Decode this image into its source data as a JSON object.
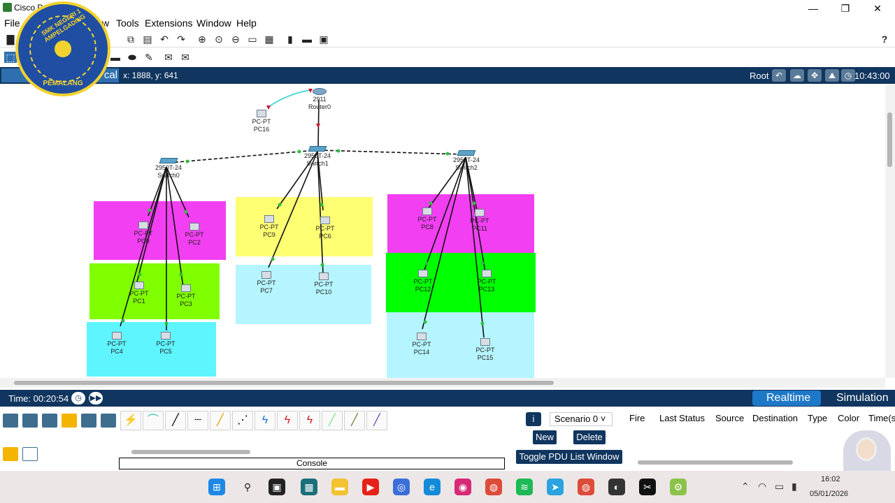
{
  "window": {
    "title": "Cisco Pa",
    "min": "—",
    "max": "❐",
    "close": "✕"
  },
  "menu": [
    "File",
    "w",
    "Tools",
    "Extensions",
    "Window",
    "Help"
  ],
  "help_icon": "?",
  "logo": {
    "top_text": "SMK NEGERI 1 AMPELGADING",
    "bottom_text": "PEMALANG"
  },
  "bluebar": {
    "tab_label": "cal",
    "coords": "x: 1888, y: 641",
    "root": "Root",
    "clock": "10:43:00"
  },
  "devices": [
    {
      "id": "router0",
      "type": "router",
      "model": "2911",
      "name": "Router0"
    },
    {
      "id": "pc16",
      "type": "pc",
      "model": "PC-PT",
      "name": "PC16"
    },
    {
      "id": "switch0",
      "type": "switch",
      "model": "2950T-24",
      "name": "Switch0"
    },
    {
      "id": "switch1",
      "type": "switch",
      "model": "2950T-24",
      "name": "Switch1"
    },
    {
      "id": "switch2",
      "type": "switch",
      "model": "2950T-24",
      "name": "Switch2"
    },
    {
      "id": "pc0",
      "type": "pc",
      "model": "PC-PT",
      "name": "PC0"
    },
    {
      "id": "pc2",
      "type": "pc",
      "model": "PC-PT",
      "name": "PC2"
    },
    {
      "id": "pc1",
      "type": "pc",
      "model": "PC-PT",
      "name": "PC1"
    },
    {
      "id": "pc3",
      "type": "pc",
      "model": "PC-PT",
      "name": "PC3"
    },
    {
      "id": "pc4",
      "type": "pc",
      "model": "PC-PT",
      "name": "PC4"
    },
    {
      "id": "pc5",
      "type": "pc",
      "model": "PC-PT",
      "name": "PC5"
    },
    {
      "id": "pc9",
      "type": "pc",
      "model": "PC-PT",
      "name": "PC9"
    },
    {
      "id": "pc6",
      "type": "pc",
      "model": "PC-PT",
      "name": "PC6"
    },
    {
      "id": "pc7",
      "type": "pc",
      "model": "PC-PT",
      "name": "PC7"
    },
    {
      "id": "pc10",
      "type": "pc",
      "model": "PC-PT",
      "name": "PC10"
    },
    {
      "id": "pc8",
      "type": "pc",
      "model": "PC-PT",
      "name": "PC8"
    },
    {
      "id": "pc11",
      "type": "pc",
      "model": "PC-PT",
      "name": "PC11"
    },
    {
      "id": "pc12",
      "type": "pc",
      "model": "PC-PT",
      "name": "PC12"
    },
    {
      "id": "pc13",
      "type": "pc",
      "model": "PC-PT",
      "name": "PC13"
    },
    {
      "id": "pc14",
      "type": "pc",
      "model": "PC-PT",
      "name": "PC14"
    },
    {
      "id": "pc15",
      "type": "pc",
      "model": "PC-PT",
      "name": "PC15"
    }
  ],
  "zone_colors": {
    "magenta": "#f23ff2",
    "lime": "#80ff00",
    "cyan": "#5ff5ff",
    "yellow": "#ffff73",
    "lightcyan": "#b5f5ff",
    "green": "#00ff00"
  },
  "status": {
    "time": "Time: 00:20:54",
    "realtime": "Realtime",
    "simulation": "Simulation"
  },
  "console": "Console",
  "pdu": {
    "scenario": "Scenario 0",
    "new": "New",
    "delete": "Delete",
    "toggle": "Toggle PDU List Window",
    "columns": [
      "Fire",
      "Last Status",
      "Source",
      "Destination",
      "Type",
      "Color",
      "Time(s"
    ]
  },
  "taskbar": {
    "time": "16:02",
    "date": "05/01/2026"
  }
}
